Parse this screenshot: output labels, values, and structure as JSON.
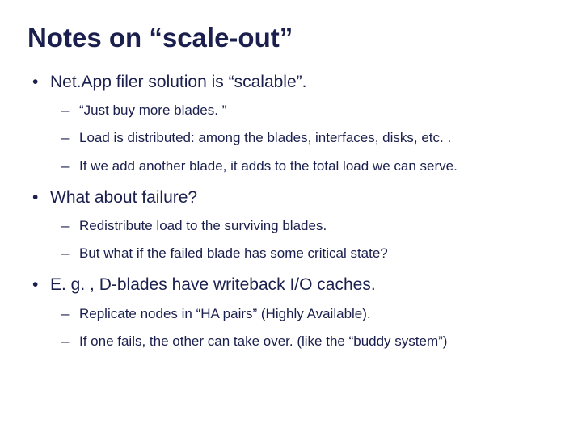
{
  "title": "Notes on “scale-out”",
  "bullets": [
    {
      "text": "Net.App filer solution is “scalable”.",
      "sub": [
        "“Just buy more blades. ”",
        "Load is distributed: among the blades, interfaces, disks, etc. .",
        "If we add another blade, it adds to the total load we can serve."
      ]
    },
    {
      "text": "What about failure?",
      "sub": [
        "Redistribute load to the surviving blades.",
        "But what if the failed blade has some critical state?"
      ]
    },
    {
      "text": "E. g. , D-blades have writeback I/O caches.",
      "sub": [
        "Replicate nodes in “HA pairs” (Highly Available).",
        "If one fails, the other can take over.  (like the “buddy system”)"
      ]
    }
  ]
}
